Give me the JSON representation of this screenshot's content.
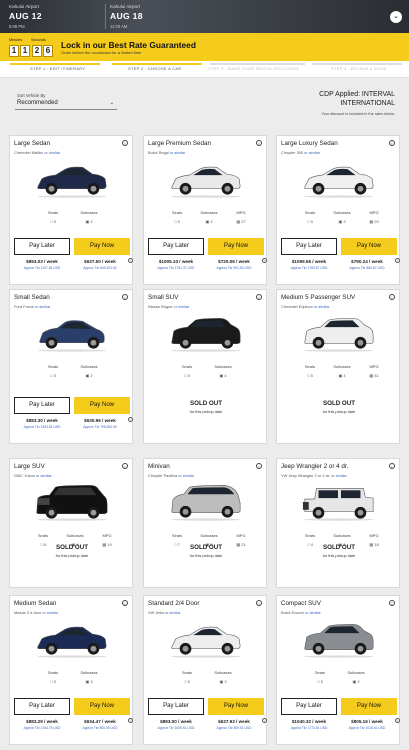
{
  "header": {
    "pickup": {
      "location": "Kahului Airport",
      "date": "AUG 12",
      "time": "5:08 PM"
    },
    "dropoff": {
      "location": "Kahului Airport",
      "date": "AUG 18",
      "time": "11:00 AM"
    }
  },
  "promo": {
    "minutes_label": "Minutes",
    "seconds_label": "Seconds",
    "digits": [
      "1",
      "1",
      "2",
      "6"
    ],
    "title": "Lock in our Best Rate Guaranteed",
    "subtitle": "Order before the countdown for a limited time"
  },
  "steps": [
    {
      "label": "STEP 1 : EDIT ITINERARY",
      "state": "done"
    },
    {
      "label": "STEP 2 : CHOOSE A CAR",
      "state": "active"
    },
    {
      "label": "STEP 3 : MAKE YOUR RENTAL EXCLUSIVE",
      "state": "todo"
    },
    {
      "label": "STEP 4 : REVIEW & BOOK",
      "state": "todo"
    }
  ],
  "sort": {
    "label": "Sort Vehicle By",
    "value": "Recommended"
  },
  "cdp": {
    "line1": "CDP Applied: INTERVAL",
    "line2": "INTERNATIONAL",
    "note": "Your discount is included in the rates below."
  },
  "labels": {
    "seats": "Seats",
    "suitcases": "Suitcases",
    "mpg": "MPG",
    "pay_later": "Pay Later",
    "pay_now": "Pay Now",
    "sold_out": "SOLD OUT",
    "sold_sub": "for this pickup date",
    "or_similar": "or similar"
  },
  "cars": [
    {
      "name": "Large Sedan",
      "model": "Chevrolet Malibu",
      "seats": "5",
      "suitcases": "4",
      "mpg": "",
      "pl": "$893.03 / week",
      "pl_alt": "Approx Tkr 1107.84 USD",
      "pn": "$637.50 / week",
      "pn_alt": "Approx Tkr 809.401.52",
      "color": "#1f2a4a",
      "sold": false,
      "type": "sedan"
    },
    {
      "name": "Large Premium Sedan",
      "model": "Buick Regal",
      "seats": "5",
      "suitcases": "4",
      "mpg": "27",
      "pl": "$1005.10 / week",
      "pl_alt": "Approx Tkr 1751.37 USD",
      "pn": "$720.06 / week",
      "pn_alt": "Approx Tkr 901.52 USD",
      "color": "#e8e8e8",
      "sold": false,
      "type": "sedan"
    },
    {
      "name": "Large Luxury Sedan",
      "model": "Chrysler 300",
      "seats": "5",
      "suitcases": "3",
      "mpg": "20",
      "pl": "$1099.55 / week",
      "pl_alt": "Approx Tkr 1783.87 USD",
      "pn": "$790.24 / week",
      "pn_alt": "Approx Tkr 864.87 USD",
      "color": "#f0f0f0",
      "sold": false,
      "type": "sedan"
    },
    {
      "name": "Small Sedan",
      "model": "Ford Focus",
      "seats": "5",
      "suitcases": "2",
      "mpg": "",
      "pl": "$883.30 / week",
      "pl_alt": "Approx Tkr 1393.81 USD",
      "pn": "$630.96 / week",
      "pn_alt": "Approx Tkr 795.551.50",
      "color": "#2a3e6a",
      "sold": false,
      "type": "hatch"
    },
    {
      "name": "Small SUV",
      "model": "Nissan Rogue",
      "seats": "5",
      "suitcases": "4",
      "mpg": "",
      "color": "#1a1a1a",
      "sold": true,
      "type": "suv"
    },
    {
      "name": "Medium 5 Passenger SUV",
      "model": "Chevrolet Equinox",
      "seats": "5",
      "suitcases": "4",
      "mpg": "31",
      "color": "#eeeeee",
      "sold": true,
      "type": "suv"
    },
    {
      "name": "Large SUV",
      "model": "GMC Yukon",
      "seats": "8",
      "suitcases": "4",
      "mpg": "19",
      "color": "#111111",
      "sold": true,
      "type": "bigsuv"
    },
    {
      "name": "Minivan",
      "model": "Chrysler Pacifica",
      "seats": "7",
      "suitcases": "5",
      "mpg": "21",
      "color": "#bdbdbd",
      "sold": true,
      "type": "van"
    },
    {
      "name": "Jeep Wrangler 2 or 4 dr.",
      "model": "VW Jeep Wrangler 2 or 4 dr.",
      "seats": "4",
      "suitcases": "1",
      "mpg": "18",
      "color": "#e6e6e6",
      "sold": true,
      "type": "jeep"
    },
    {
      "name": "Medium Sedan",
      "model": "Mazda 3 4-door",
      "seats": "5",
      "suitcases": "3",
      "mpg": "",
      "pl": "$883.29 / week",
      "pl_alt": "Approx Tkr 1764.76 USD",
      "pn": "$634.47 / week",
      "pn_alt": "Approx Tkr 800.95 USD",
      "color": "#1b2b55",
      "sold": false,
      "type": "sedan"
    },
    {
      "name": "Standard 2/4 Door",
      "model": "VW Jetta",
      "seats": "5",
      "suitcases": "3",
      "mpg": "",
      "pl": "$893.00 / week",
      "pl_alt": "Approx Tkr 1069.51 USD",
      "pn": "$637.93 / week",
      "pn_alt": "Approx Tkr 809.51 USD",
      "color": "#eeeeee",
      "sold": false,
      "type": "sedan"
    },
    {
      "name": "Compact SUV",
      "model": "Buick Encore",
      "seats": "5",
      "suitcases": "2",
      "mpg": "",
      "pl": "$1040.32 / week",
      "pl_alt": "Approx Tkr 1771.61 USD",
      "pn": "$805.16 / week",
      "pn_alt": "Approx Tkr 1016.41 USD",
      "color": "#8a8d92",
      "sold": false,
      "type": "suv"
    }
  ]
}
